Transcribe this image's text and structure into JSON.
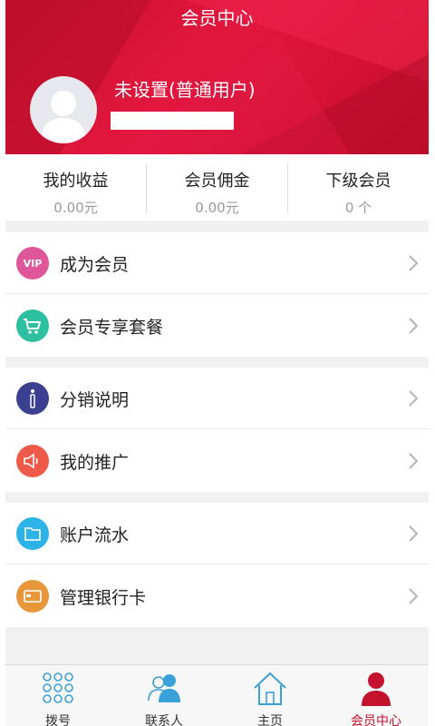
{
  "header": {
    "title": "会员中心",
    "user_name": "未设置(普通用户)"
  },
  "stats": [
    {
      "label": "我的收益",
      "value": "0.00元"
    },
    {
      "label": "会员佣金",
      "value": "0.00元"
    },
    {
      "label": "下级会员",
      "value": "0 个"
    }
  ],
  "menu": {
    "group1": [
      {
        "label": "成为会员",
        "icon": "vip-icon",
        "icon_text": "VIP",
        "color": "#e0569a"
      },
      {
        "label": "会员专享套餐",
        "icon": "shopping-cart-icon",
        "color": "#2cbfa0"
      }
    ],
    "group2": [
      {
        "label": "分销说明",
        "icon": "info-icon",
        "color": "#3a3f8f"
      },
      {
        "label": "我的推广",
        "icon": "megaphone-icon",
        "color": "#ee5a4a"
      }
    ],
    "group3": [
      {
        "label": "账户流水",
        "icon": "folder-icon",
        "color": "#2db3e8"
      },
      {
        "label": "管理银行卡",
        "icon": "bank-card-icon",
        "color": "#e8963a"
      }
    ]
  },
  "tabs": [
    {
      "label": "拨号",
      "icon": "dialpad-icon",
      "active": false
    },
    {
      "label": "联系人",
      "icon": "contacts-icon",
      "active": false
    },
    {
      "label": "主页",
      "icon": "home-icon",
      "active": false
    },
    {
      "label": "会员中心",
      "icon": "member-icon",
      "active": true
    }
  ],
  "colors": {
    "header_red": "#d8143a",
    "active_tab": "#c4122f",
    "page_bg": "#f1f1f1"
  }
}
